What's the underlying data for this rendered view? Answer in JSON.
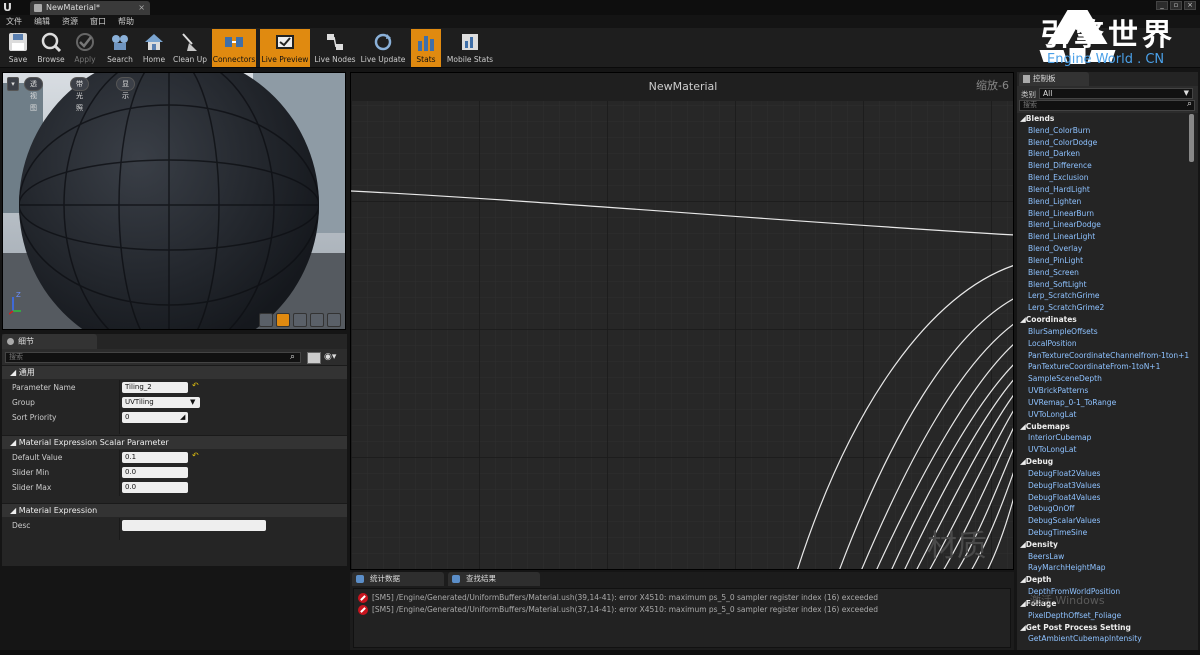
{
  "window": {
    "tab_title": "NewMaterial*",
    "tab_close": "×",
    "logo_glyph": "U",
    "controls": [
      "_",
      "▫",
      "×"
    ]
  },
  "menu": [
    "文件",
    "编辑",
    "资源",
    "窗口",
    "帮助"
  ],
  "toolbar": [
    {
      "label": "Save",
      "icon": "save-icon"
    },
    {
      "label": "Browse",
      "icon": "browse-icon"
    },
    {
      "label": "Apply",
      "icon": "apply-icon"
    },
    {
      "label": "Search",
      "icon": "search-icon"
    },
    {
      "label": "Home",
      "icon": "home-icon"
    },
    {
      "label": "Clean Up",
      "icon": "cleanup-icon"
    },
    {
      "label": "Connectors",
      "icon": "connectors-icon"
    },
    {
      "label": "Live Preview",
      "icon": "live-preview-icon"
    },
    {
      "label": "Live Nodes",
      "icon": "live-nodes-icon"
    },
    {
      "label": "Live Update",
      "icon": "live-update-icon"
    },
    {
      "label": "Stats",
      "icon": "stats-icon"
    },
    {
      "label": "Mobile Stats",
      "icon": "mobile-stats-icon"
    }
  ],
  "brand": {
    "cn": "引擎世界",
    "en": "Engine World . CN"
  },
  "viewport": {
    "buttons": [
      "透视图",
      "带光照",
      "显示"
    ],
    "axis_label": "Z"
  },
  "details": {
    "tab_label": "细节",
    "search_placeholder": "搜索",
    "sections": {
      "general": "通用",
      "scalar": "Material Expression Scalar Parameter",
      "expression": "Material Expression"
    },
    "params": {
      "parameter_name_label": "Parameter Name",
      "parameter_name_value": "Tiling_2",
      "group_label": "Group",
      "group_value": "UVTiling",
      "sort_priority_label": "Sort Priority",
      "sort_priority_value": "0",
      "default_value_label": "Default Value",
      "default_value_value": "0.1",
      "slider_min_label": "Slider Min",
      "slider_min_value": "0.0",
      "slider_max_label": "Slider Max",
      "slider_max_value": "0.0",
      "desc_label": "Desc",
      "desc_value": ""
    }
  },
  "graph": {
    "title": "NewMaterial",
    "zoom": "缩放-6",
    "watermark": "材质"
  },
  "log": {
    "tabs": [
      "统计数据",
      "查找结果"
    ],
    "messages": [
      "[SM5] /Engine/Generated/UniformBuffers/Material.ush(39,14-41): error X4510: maximum ps_5_0 sampler register index (16) exceeded",
      "[SM5] /Engine/Generated/UniformBuffers/Material.ush(37,14-41): error X4510: maximum ps_5_0 sampler register index (16) exceeded"
    ]
  },
  "palette": {
    "tab_label": "控制板",
    "category_label": "类别",
    "category_value": "All",
    "search_placeholder": "搜索",
    "groups": [
      {
        "name": "Blends",
        "items": [
          "Blend_ColorBurn",
          "Blend_ColorDodge",
          "Blend_Darken",
          "Blend_Difference",
          "Blend_Exclusion",
          "Blend_HardLight",
          "Blend_Lighten",
          "Blend_LinearBurn",
          "Blend_LinearDodge",
          "Blend_LinearLight",
          "Blend_Overlay",
          "Blend_PinLight",
          "Blend_Screen",
          "Blend_SoftLight",
          "Lerp_ScratchGrime",
          "Lerp_ScratchGrime2"
        ]
      },
      {
        "name": "Coordinates",
        "items": [
          "BlurSampleOffsets",
          "LocalPosition",
          "PanTextureCoordinateChannelfrom-1ton+1",
          "PanTextureCoordinateFrom-1toN+1",
          "SampleSceneDepth",
          "UVBrickPatterns",
          "UVRemap_0-1_ToRange",
          "UVToLongLat"
        ]
      },
      {
        "name": "Cubemaps",
        "items": [
          "InteriorCubemap",
          "UVToLongLat"
        ]
      },
      {
        "name": "Debug",
        "items": [
          "DebugFloat2Values",
          "DebugFloat3Values",
          "DebugFloat4Values",
          "DebugOnOff",
          "DebugScalarValues",
          "DebugTimeSine"
        ]
      },
      {
        "name": "Density",
        "items": [
          "BeersLaw",
          "RayMarchHeightMap"
        ]
      },
      {
        "name": "Depth",
        "items": [
          "DepthFromWorldPosition"
        ]
      },
      {
        "name": "Foliage",
        "items": [
          "PixelDepthOffset_Foliage"
        ]
      },
      {
        "name": "Get Post Process Setting",
        "items": [
          "GetAmbientCubemapIntensity"
        ]
      }
    ],
    "overlay_text": "激活 Windows"
  }
}
